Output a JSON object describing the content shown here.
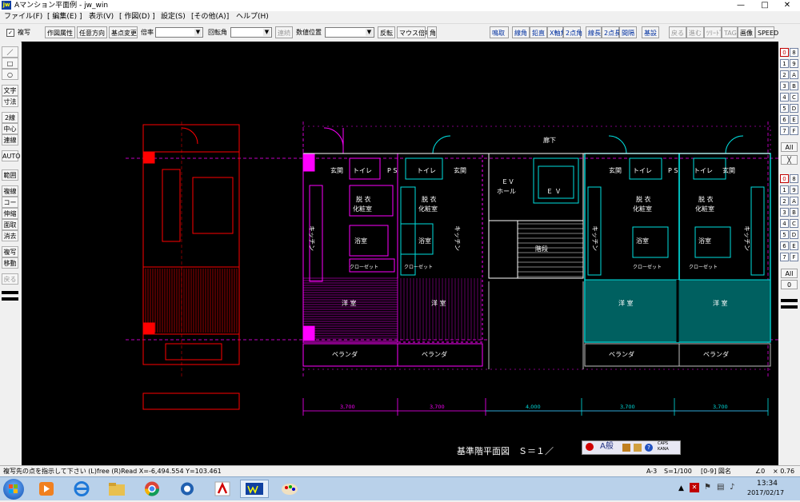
{
  "window": {
    "app_icon": "jw",
    "title": "Aマンション平面例 - jw_win",
    "minimize": "—",
    "maximize": "□",
    "close": "✕"
  },
  "menu": [
    "ファイル(F)",
    "[ 編集(E) ]",
    "表示(V)",
    "[ 作図(D) ]",
    "設定(S)",
    "[その他(A)]",
    "ヘルプ(H)"
  ],
  "toolbar": {
    "mode_check": "✓",
    "mode_label": "複写",
    "buttons_left": [
      "作図属性",
      "任意方向",
      "基点変更"
    ],
    "scale_label": "倍率",
    "rotation_label": "回転角",
    "continuous": "連続",
    "coord_label": "数値位置",
    "buttons_mid": [
      "反転",
      "マウス倍率",
      "角"
    ],
    "buttons_blue": [
      "鳴取",
      "線角",
      "鉛直",
      "X軸角",
      "2点角",
      "線長",
      "2点長",
      "間隔",
      "基設"
    ],
    "buttons_gray": [
      "戻る",
      "進む",
      "ﾂﾘｰﾄﾞ",
      "TAG"
    ],
    "buttons_right": [
      "画像",
      "SPEED"
    ]
  },
  "left_tools": [
    "／",
    "□",
    "○",
    "文字",
    "寸法",
    "2線",
    "中心線",
    "連線",
    "AUTO",
    "範囲",
    "複線",
    "コーナー",
    "伸縮",
    "面取",
    "消去",
    "複写",
    "移動",
    "戻る"
  ],
  "right_tools": {
    "layers_top": [
      [
        "0",
        "8"
      ],
      [
        "1",
        "9"
      ],
      [
        "2",
        "A"
      ],
      [
        "3",
        "B"
      ],
      [
        "4",
        "C"
      ],
      [
        "5",
        "D"
      ],
      [
        "6",
        "E"
      ],
      [
        "7",
        "F"
      ]
    ],
    "all_label": "All",
    "x_label": "╳",
    "layers_bottom": [
      [
        "0",
        "8"
      ],
      [
        "1",
        "9"
      ],
      [
        "2",
        "A"
      ],
      [
        "3",
        "B"
      ],
      [
        "4",
        "C"
      ],
      [
        "5",
        "D"
      ],
      [
        "6",
        "E"
      ],
      [
        "7",
        "F"
      ]
    ],
    "all2_label": "All",
    "zero_label": "0"
  },
  "drawing": {
    "corridor": "廊下",
    "rooms": [
      "玄関",
      "トイレ",
      "ＰＳ",
      "脱衣",
      "化粧室",
      "キッチン",
      "浴室",
      "クローゼット",
      "洋室",
      "ベランダ",
      "ＥＶ",
      "ホール",
      "階段"
    ],
    "unit_genkan": "玄関",
    "unit_toilet": "トイレ",
    "ps": "P S",
    "datsui": "脱 衣",
    "keshou": "化粧室",
    "kitchen": "キッチン",
    "yokushitsu": "浴室",
    "closet": "クローゼット",
    "youshitsu": "洋 室",
    "veranda": "ベランダ",
    "ev": "ＥＶ",
    "hall": "ホール",
    "ev2": "Ｅ Ｖ",
    "kaidan": "階段",
    "dims": [
      "3,700",
      "3,700",
      "4,000",
      "3,700",
      "3,700"
    ],
    "drawing_title": "基準階平面図　Ｓ＝１／"
  },
  "ime": {
    "mode": "A般",
    "caps": "CAPS",
    "kana": "KANA"
  },
  "status": {
    "message": "複写先の点を指示して下さい (L)free (R)Read X=-6,494.554 Y=103.461",
    "layer": "A-3",
    "scale": "S=1/100",
    "group": "[0-9] 図名",
    "angle": "∠0",
    "zoom": "× 0.76"
  },
  "taskbar": {
    "time": "13:34",
    "date": "2017/02/17"
  },
  "colors": {
    "magenta": "#ff00ff",
    "cyan": "#00e0e0",
    "red": "#ff0000",
    "white": "#ffffff",
    "canvas": "#000000"
  }
}
